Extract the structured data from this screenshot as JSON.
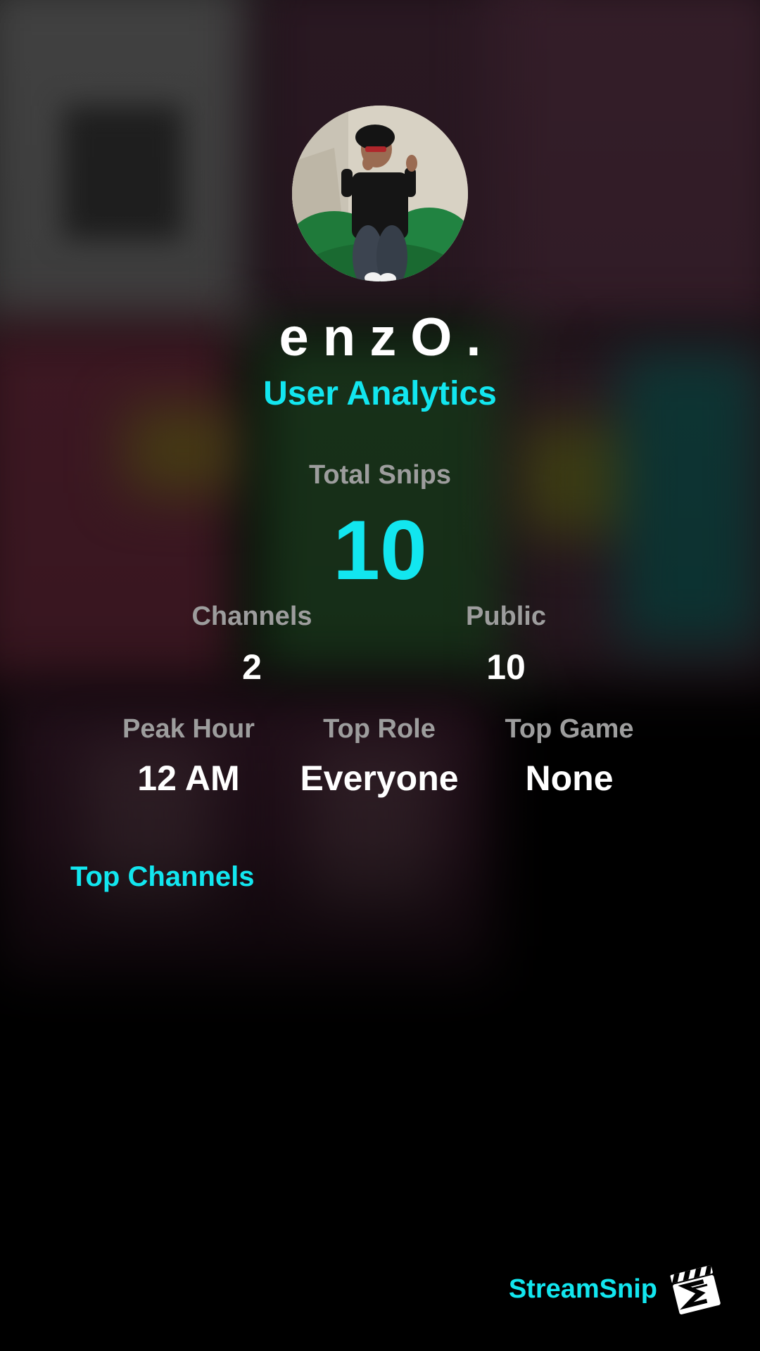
{
  "profile": {
    "username": "enzO.",
    "subtitle": "User Analytics"
  },
  "stats": {
    "total_snips_label": "Total Snips",
    "total_snips_value": "10",
    "channels_label": "Channels",
    "channels_value": "2",
    "public_label": "Public",
    "public_value": "10",
    "peak_hour_label": "Peak Hour",
    "peak_hour_value": "12 AM",
    "top_role_label": "Top Role",
    "top_role_value": "Everyone",
    "top_game_label": "Top Game",
    "top_game_value": "None"
  },
  "sections": {
    "top_channels_title": "Top Channels"
  },
  "footer": {
    "brand_name": "StreamSnip",
    "logo_icon": "clapperboard-icon"
  },
  "colors": {
    "accent": "#12e6ef",
    "label": "#9d9d9d",
    "background": "#000000"
  }
}
